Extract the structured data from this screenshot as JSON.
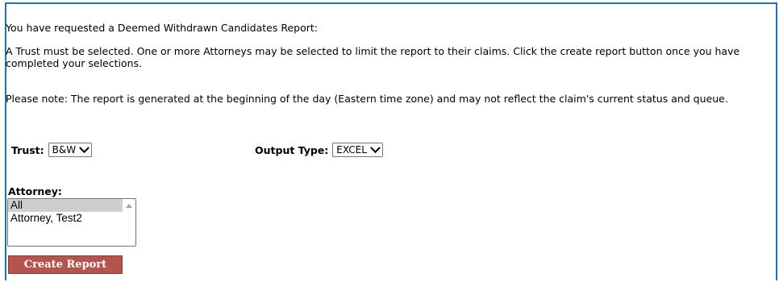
{
  "intro": "You have requested a Deemed Withdrawn Candidates Report:",
  "instructions": "A Trust must be selected. One or more Attorneys may be selected to limit the report to their claims. Click the create report button once you have completed your selections.",
  "note": "Please note: The report is generated at the beginning of the day (Eastern time zone) and may not reflect the claim's current status and queue.",
  "trust": {
    "label": "Trust:",
    "value": "B&W"
  },
  "output_type": {
    "label": "Output Type:",
    "value": "EXCEL"
  },
  "attorney": {
    "label": "Attorney:",
    "options": [
      {
        "label": "All",
        "selected": true
      },
      {
        "label": "Attorney, Test2",
        "selected": false
      }
    ]
  },
  "create_button": "Create Report",
  "colors": {
    "frame_border": "#1e73be",
    "button_bg": "#b5544e"
  }
}
